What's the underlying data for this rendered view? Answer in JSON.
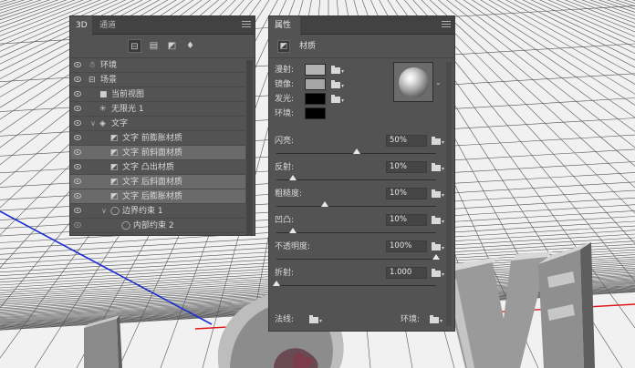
{
  "panel3d": {
    "tabs": [
      "3D",
      "通道"
    ],
    "toolbar_icons": [
      "scene-filter-icon",
      "mesh-filter-icon",
      "material-filter-icon",
      "light-filter-icon"
    ],
    "rows": [
      {
        "label": "环境",
        "icon": "environment-icon",
        "indent": 0,
        "caret": ""
      },
      {
        "label": "场景",
        "icon": "scene-icon",
        "indent": 0,
        "caret": ""
      },
      {
        "label": "当前视图",
        "icon": "camera-icon",
        "indent": 1,
        "caret": ""
      },
      {
        "label": "无限光 1",
        "icon": "infinite-light-icon",
        "indent": 1,
        "caret": ""
      },
      {
        "label": "文字",
        "icon": "mesh-icon",
        "indent": 1,
        "caret": "v"
      },
      {
        "label": "文字 前膨胀材质",
        "icon": "material-icon",
        "indent": 2,
        "caret": ""
      },
      {
        "label": "文字 前斜面材质",
        "icon": "material-icon",
        "indent": 2,
        "caret": ""
      },
      {
        "label": "文字 凸出材质",
        "icon": "material-icon",
        "indent": 2,
        "caret": ""
      },
      {
        "label": "文字 后斜面材质",
        "icon": "material-icon",
        "indent": 2,
        "caret": ""
      },
      {
        "label": "文字 后膨胀材质",
        "icon": "material-icon",
        "indent": 2,
        "caret": ""
      },
      {
        "label": "边界约束 1",
        "icon": "constraint-icon",
        "indent": 2,
        "caret": "v"
      },
      {
        "label": "内部约束 2",
        "icon": "constraint-icon",
        "indent": 3,
        "caret": ""
      }
    ]
  },
  "props": {
    "tab": "属性",
    "header_label": "材质",
    "swatches": [
      {
        "label": "漫射:",
        "color": "#b3b3b3"
      },
      {
        "label": "镜像:",
        "color": "#a6a6a6"
      },
      {
        "label": "发光:",
        "color": "#000000"
      },
      {
        "label": "环境:",
        "color": "#000000"
      }
    ],
    "params": [
      {
        "label": "闪亮:",
        "value": "50%",
        "level": 0.5
      },
      {
        "label": "反射:",
        "value": "10%",
        "level": 0.1
      },
      {
        "label": "粗糙度:",
        "value": "10%",
        "level": 0.3
      },
      {
        "label": "凹凸:",
        "value": "10%",
        "level": 0.1
      },
      {
        "label": "不透明度:",
        "value": "100%",
        "level": 1.0
      },
      {
        "label": "折射:",
        "value": "1.000",
        "level": 0.0
      }
    ],
    "normal_label": "法线:",
    "environment_label": "环境:"
  }
}
